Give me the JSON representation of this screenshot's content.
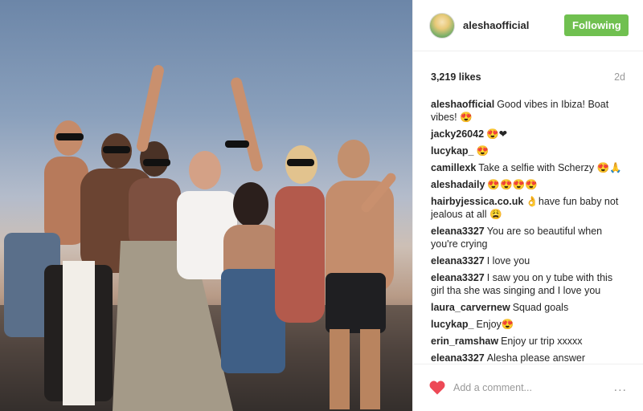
{
  "post": {
    "author": "aleshaofficial",
    "follow_label": "Following",
    "likes": "3,219 likes",
    "age": "2d"
  },
  "comments": [
    {
      "user": "aleshaofficial",
      "text": "Good vibes in Ibiza! Boat vibes! 😍"
    },
    {
      "user": "jacky26042",
      "text": "😍❤"
    },
    {
      "user": "lucykap_",
      "text": "😍"
    },
    {
      "user": "camillexk",
      "text": "Take a selfie with Scherzy 😍🙏"
    },
    {
      "user": "aleshadaily",
      "text": "😍😍😍😍"
    },
    {
      "user": "hairbyjessica.co.uk",
      "text": "👌have fun baby not jealous at all 😩"
    },
    {
      "user": "eleana3327",
      "text": "You are so beautiful when you're crying"
    },
    {
      "user": "eleana3327",
      "text": "I love you"
    },
    {
      "user": "eleana3327",
      "text": "I saw you on y tube with this girl tha she was singing and I love you"
    },
    {
      "user": "laura_carvernew",
      "text": "Squad goals"
    },
    {
      "user": "lucykap_",
      "text": "Enjoy😍"
    },
    {
      "user": "erin_ramshaw",
      "text": "Enjoy ur trip xxxxx"
    },
    {
      "user": "eleana3327",
      "text": "Alesha please answer"
    }
  ],
  "footer": {
    "comment_placeholder": "Add a comment...",
    "more_label": "...",
    "heart_color": "#ed4956"
  },
  "colors": {
    "follow_button": "#70c050",
    "text": "#262626",
    "muted": "#999999"
  }
}
